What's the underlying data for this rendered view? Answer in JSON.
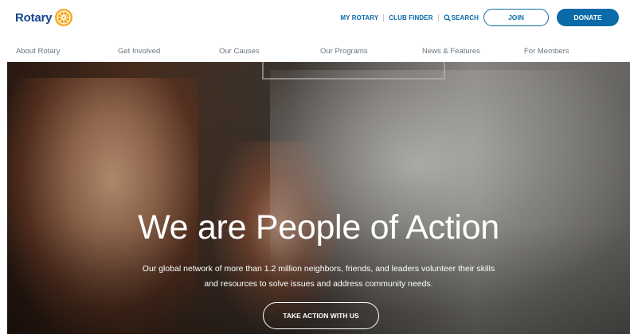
{
  "header": {
    "logo_text": "Rotary",
    "utility_links": {
      "my_rotary": "MY ROTARY",
      "club_finder": "CLUB FINDER",
      "search": "SEARCH"
    },
    "join_label": "JOIN",
    "donate_label": "DONATE"
  },
  "nav": {
    "items": [
      {
        "label": "About Rotary"
      },
      {
        "label": "Get Involved"
      },
      {
        "label": "Our Causes"
      },
      {
        "label": "Our Programs"
      },
      {
        "label": "News & Features"
      },
      {
        "label": "For Members"
      }
    ]
  },
  "hero": {
    "title": "We are People of Action",
    "subtitle": "Our global network of more than 1.2 million neighbors, friends, and leaders volunteer their skills and resources to solve issues and address community needs.",
    "cta_label": "TAKE ACTION WITH US"
  },
  "colors": {
    "brand_blue": "#17458f",
    "link_blue": "#0a6ba8",
    "gold": "#f7a81b",
    "nav_gray": "#6a7580"
  },
  "icons": {
    "logo": "rotary-wheel-icon",
    "search": "magnifier-icon"
  }
}
